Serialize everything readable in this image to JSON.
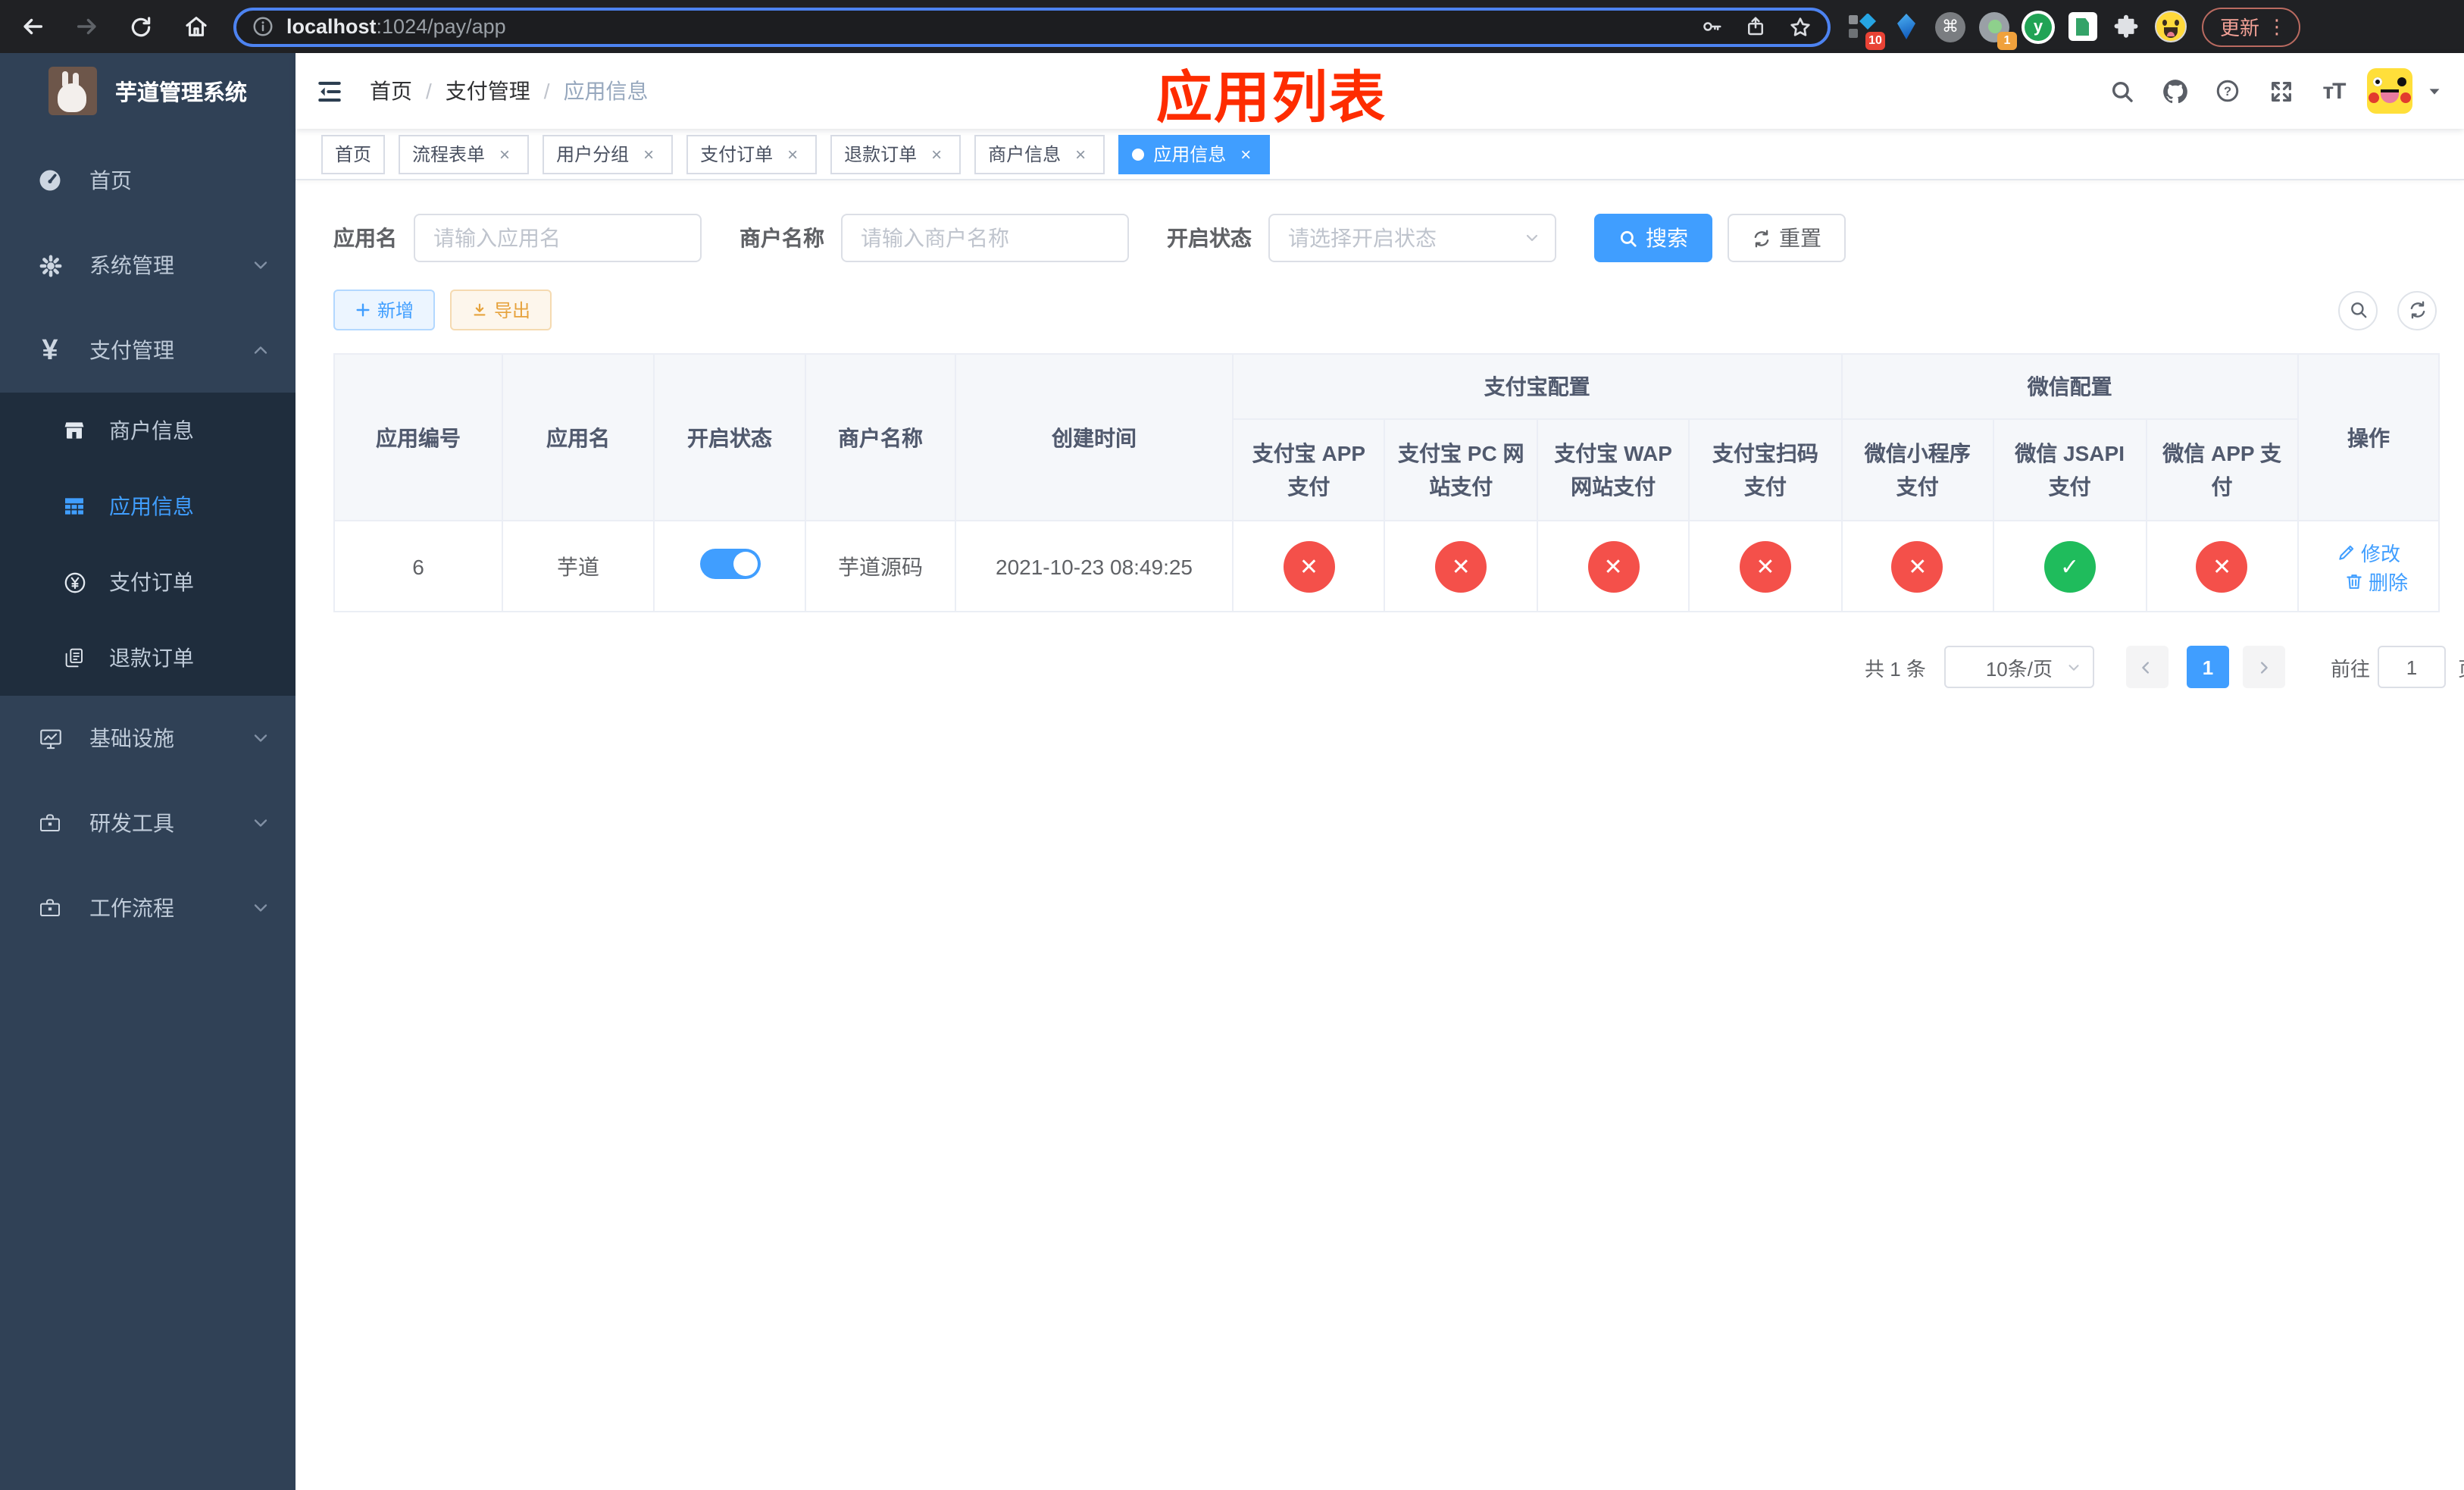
{
  "browser": {
    "url_host": "localhost",
    "url_path": ":1024/pay/app",
    "update_label": "更新",
    "kebab": "⋮",
    "extensions": [
      {
        "key": "pin",
        "badge": "10"
      },
      {
        "key": "kite"
      },
      {
        "key": "command"
      },
      {
        "key": "target",
        "badge": "1"
      },
      {
        "key": "green-y"
      },
      {
        "key": "doc"
      },
      {
        "key": "puzzle"
      },
      {
        "key": "emoji"
      }
    ]
  },
  "sidebar": {
    "title": "芋道管理系统",
    "menu": [
      {
        "key": "home",
        "label": "首页",
        "icon": "dashboard"
      },
      {
        "key": "system",
        "label": "系统管理",
        "icon": "gear",
        "chevron": "down"
      },
      {
        "key": "payment",
        "label": "支付管理",
        "icon": "yen",
        "chevron": "up",
        "expanded": true,
        "children": [
          {
            "key": "merchant-info",
            "label": "商户信息",
            "icon": "shop"
          },
          {
            "key": "app-info",
            "label": "应用信息",
            "icon": "grid",
            "active": true
          },
          {
            "key": "pay-order",
            "label": "支付订单",
            "icon": "yen-circle"
          },
          {
            "key": "refund-order",
            "label": "退款订单",
            "icon": "docs"
          }
        ]
      },
      {
        "key": "infra",
        "label": "基础设施",
        "icon": "monitor",
        "chevron": "down"
      },
      {
        "key": "devtools",
        "label": "研发工具",
        "icon": "toolbox",
        "chevron": "down"
      },
      {
        "key": "workflow",
        "label": "工作流程",
        "icon": "briefcase",
        "chevron": "down"
      }
    ]
  },
  "header": {
    "breadcrumb": [
      "首页",
      "支付管理",
      "应用信息"
    ],
    "annotation": "应用列表"
  },
  "tags": [
    {
      "key": "home",
      "label": "首页",
      "closable": false,
      "active": false
    },
    {
      "key": "flow-form",
      "label": "流程表单",
      "closable": true,
      "active": false
    },
    {
      "key": "user-group",
      "label": "用户分组",
      "closable": true,
      "active": false
    },
    {
      "key": "pay-order",
      "label": "支付订单",
      "closable": true,
      "active": false
    },
    {
      "key": "refund-order",
      "label": "退款订单",
      "closable": true,
      "active": false
    },
    {
      "key": "merchant-info",
      "label": "商户信息",
      "closable": true,
      "active": false
    },
    {
      "key": "app-info",
      "label": "应用信息",
      "closable": true,
      "active": true
    }
  ],
  "filters": {
    "app_name_label": "应用名",
    "app_name_placeholder": "请输入应用名",
    "merchant_label": "商户名称",
    "merchant_placeholder": "请输入商户名称",
    "status_label": "开启状态",
    "status_placeholder": "请选择开启状态",
    "search_label": "搜索",
    "reset_label": "重置"
  },
  "toolbar": {
    "add_label": "新增",
    "export_label": "导出"
  },
  "table": {
    "top_row": [
      {
        "key": "app-id",
        "label": "应用编号",
        "rowspan": 2,
        "width": 111
      },
      {
        "key": "app-name",
        "label": "应用名",
        "rowspan": 2,
        "width": 100
      },
      {
        "key": "enabled",
        "label": "开启状态",
        "rowspan": 2,
        "width": 100
      },
      {
        "key": "merchant-name",
        "label": "商户名称",
        "rowspan": 2,
        "width": 99
      },
      {
        "key": "create-time",
        "label": "创建时间",
        "rowspan": 2,
        "width": 183
      },
      {
        "key": "alipay-group",
        "label": "支付宝配置",
        "colspan": 4
      },
      {
        "key": "wechat-group",
        "label": "微信配置",
        "colspan": 3
      },
      {
        "key": "actions",
        "label": "操作",
        "rowspan": 2,
        "width": 93
      }
    ],
    "sub_row": [
      {
        "key": "alipay-app",
        "label": "支付宝 APP 支付",
        "width": 101
      },
      {
        "key": "alipay-pc",
        "label": "支付宝 PC 网站支付",
        "width": 102
      },
      {
        "key": "alipay-wap",
        "label": "支付宝 WAP 网站支付",
        "width": 99
      },
      {
        "key": "alipay-qr",
        "label": "支付宝扫码支付",
        "width": 99
      },
      {
        "key": "wx-lite",
        "label": "微信小程序支付",
        "width": 102
      },
      {
        "key": "wx-jsapi",
        "label": "微信 JSAPI 支付",
        "width": 101
      },
      {
        "key": "wx-app",
        "label": "微信 APP 支付",
        "width": 101
      }
    ],
    "row": {
      "app_id": "6",
      "app_name": "芋道",
      "enabled": true,
      "merchant_name": "芋道源码",
      "create_time": "2021-10-23 08:49:25",
      "statuses": [
        false,
        false,
        false,
        false,
        false,
        true,
        false
      ],
      "edit_label": "修改",
      "delete_label": "删除"
    }
  },
  "pagination": {
    "total": "共 1 条",
    "page_size": "10条/页",
    "page": "1",
    "goto_prefix": "前往",
    "goto_value": "1",
    "goto_suffix": "页"
  },
  "colors": {
    "primary": "#409eff",
    "annotation_red": "#fe2c00",
    "success_green": "#1fbc5c",
    "danger_red": "#f4504a",
    "sidebar_bg": "#304156",
    "submenu_bg": "#1f2d3d",
    "warning_orange": "#e6a23c"
  }
}
